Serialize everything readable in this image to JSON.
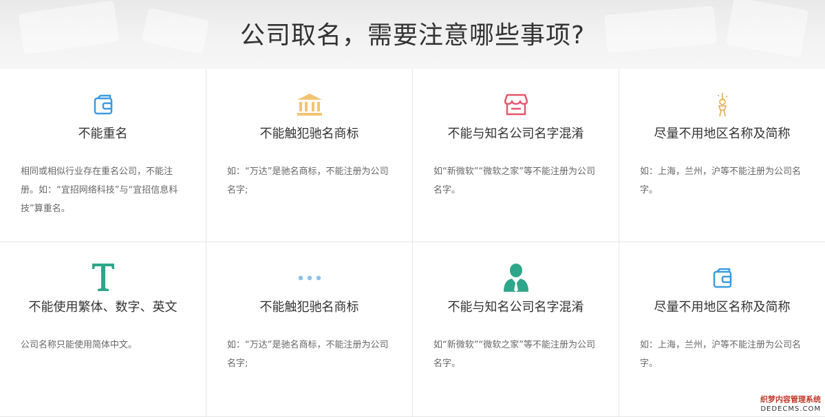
{
  "header": {
    "title": "公司取名，需要注意哪些事项?"
  },
  "cards": [
    {
      "icon": "wallet-icon",
      "title": "不能重名",
      "desc": "相同或相似行业存在重名公司，不能注册。如：“宜招网络科技”与“宜招信息科技”算重名。",
      "color": "#3a9be0"
    },
    {
      "icon": "bank-icon",
      "title": "不能触犯驰名商标",
      "desc": "如：“万达”是驰名商标，不能注册为公司名字;",
      "color": "#f2c472"
    },
    {
      "icon": "shop-icon",
      "title": "不能与知名公司名字混淆",
      "desc": "如“新微软”“微软之家”等不能注册为公司名字。",
      "color": "#e8556a"
    },
    {
      "icon": "tower-icon",
      "title": "尽量不用地区名称及简称",
      "desc": "如：上海，兰州，沪等不能注册为公司名字。",
      "color": "#e0a850"
    },
    {
      "icon": "letter-t-icon",
      "title": "不能使用繁体、数字、英文",
      "desc": "公司名称只能使用简体中文。",
      "color": "#2ea68a"
    },
    {
      "icon": "dots-icon",
      "title": "不能触犯驰名商标",
      "desc": "如：“万达”是驰名商标，不能注册为公司名字;",
      "color": "#8cc0e6"
    },
    {
      "icon": "person-icon",
      "title": "不能与知名公司名字混淆",
      "desc": "如“新微软”“微软之家”等不能注册为公司名字。",
      "color": "#2ea68a"
    },
    {
      "icon": "wallet-icon",
      "title": "尽量不用地区名称及简称",
      "desc": "如：上海，兰州，沪等不能注册为公司名字。",
      "color": "#3a9be0"
    }
  ],
  "watermark": {
    "line1": "织梦内容管理系统",
    "line2": "DEDECMS.COM"
  }
}
